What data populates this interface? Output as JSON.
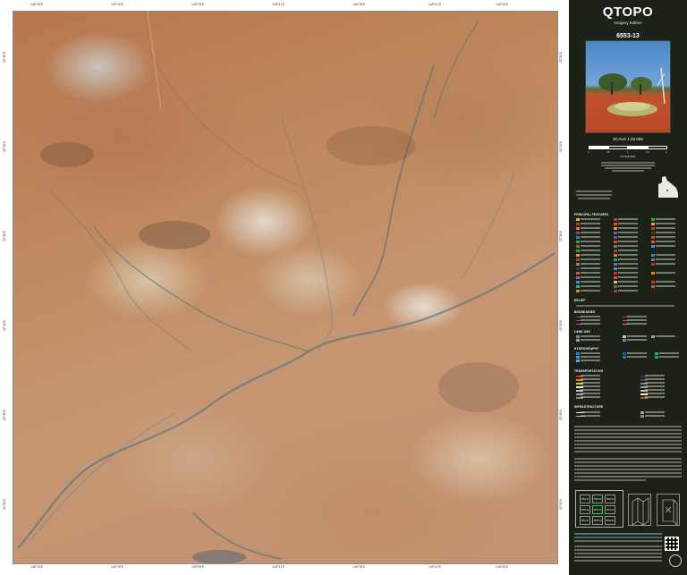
{
  "map": {
    "grid_top": [
      "148°15'E",
      "149°19'E",
      "149°25'E",
      "149°31'E",
      "149°35'E",
      "149°41'E",
      "149°43'E"
    ],
    "grid_bottom": [
      "148°15'E",
      "149°19'E",
      "149°25'E",
      "149°31'E",
      "149°35'E",
      "149°41'E",
      "149°43'E"
    ],
    "grid_left": [
      "22°30'S",
      "22°34'S",
      "22°38'S",
      "22°42'S",
      "22°46'S",
      "22°50'S"
    ],
    "grid_right": [
      "22°30'S",
      "22°34'S",
      "22°38'S",
      "22°42'S",
      "22°46'S",
      "22°50'S"
    ]
  },
  "panel": {
    "brand_title": "QTOPO",
    "brand_subtitle": "Imagery Edition",
    "sheet_number": "6553-13",
    "scale": "SCALE 1:25 000",
    "scale_ticks": [
      "0",
      "0.5",
      "1",
      "1.5",
      "2"
    ],
    "scale_unit": "KILOMETRES",
    "legend_headings": [
      "PRINCIPAL FEATURES",
      "RELIEF",
      "BOUNDARIES",
      "LAND USE",
      "HYDROGRAPHY",
      "TRANSPORTATION",
      "INFRASTRUCTURE"
    ],
    "index_cells": [
      "6553-21",
      "6553-22",
      "6553-23",
      "6553-14",
      "6553-13",
      "6553-12",
      "6553-04",
      "6553-03",
      "6553-02"
    ],
    "accent_color": "#1c2217"
  }
}
